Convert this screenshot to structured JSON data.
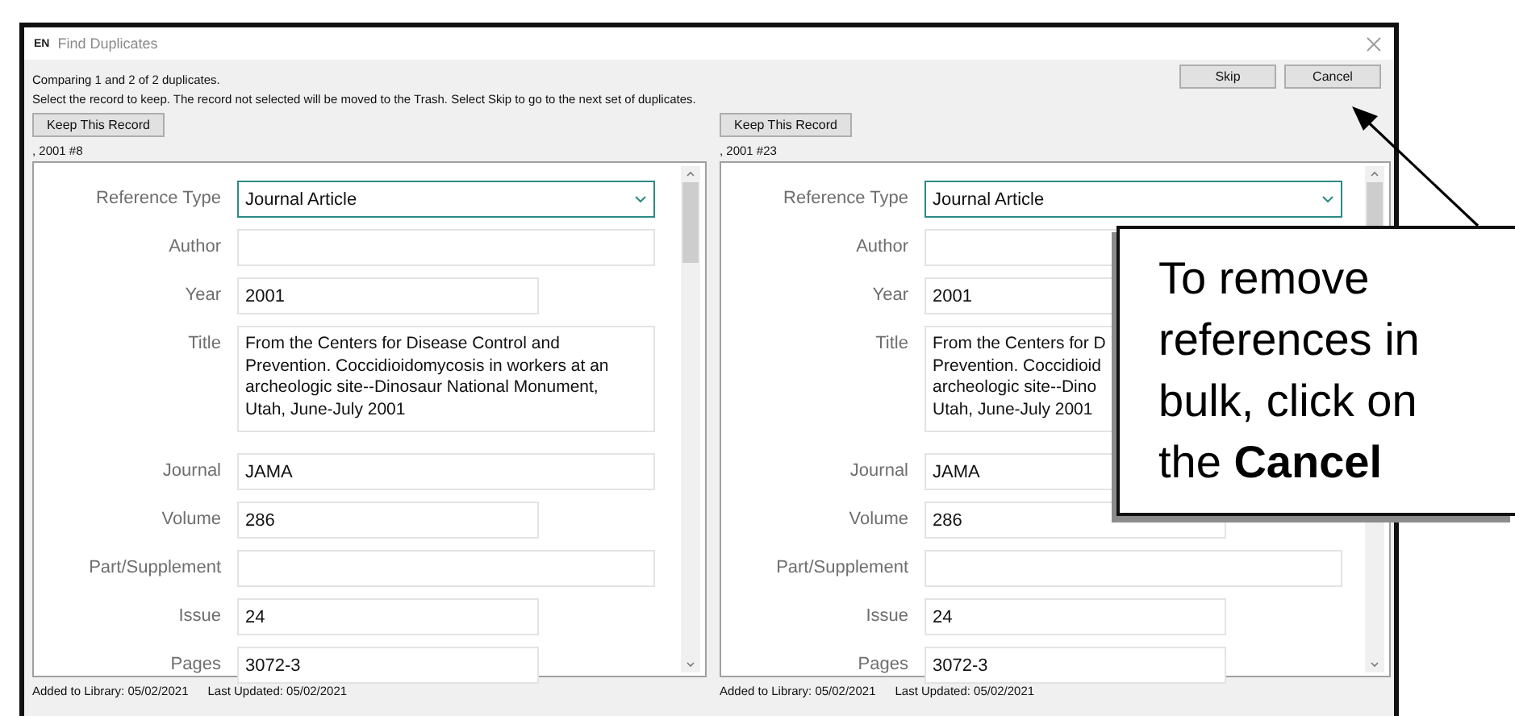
{
  "window": {
    "badge": "EN",
    "title": "Find Duplicates"
  },
  "summary": "Comparing 1 and 2 of 2 duplicates.",
  "instructions": "Select the record to keep. The record not selected will be moved to the Trash. Select Skip to go to the next set of duplicates.",
  "buttons": [
    "Skip",
    "Cancel"
  ],
  "records": [
    {
      "keep_button": "Keep This Record",
      "heading": ", 2001 #8",
      "fields": [
        {
          "label": "Reference Type",
          "kind": "dropdown",
          "value": "Journal Article"
        },
        {
          "label": "Author",
          "kind": "wide"
        },
        {
          "label": "Year",
          "kind": "narrow",
          "value": "2001"
        },
        {
          "label": "Title",
          "kind": "multiline",
          "lines": [
            "From the Centers for Disease Control and",
            "Prevention. Coccidioidomycosis in workers at an",
            "archeologic site--Dinosaur National Monument,",
            "Utah, June-July 2001"
          ]
        },
        {
          "label": "Journal",
          "kind": "wide",
          "value": "JAMA"
        },
        {
          "label": "Volume",
          "kind": "narrow",
          "value": "286"
        },
        {
          "label": "Part/Supplement",
          "kind": "wide"
        },
        {
          "label": "Issue",
          "kind": "narrow",
          "value": "24"
        },
        {
          "label": "Pages",
          "kind": "narrow",
          "value": "3072-3"
        }
      ],
      "added": "Added to Library: 05/02/2021",
      "updated": "Last Updated: 05/02/2021"
    },
    {
      "keep_button": "Keep This Record",
      "heading": ", 2001 #23",
      "fields": [
        {
          "label": "Reference Type",
          "kind": "dropdown",
          "value": "Journal Article"
        },
        {
          "label": "Author",
          "kind": "wide"
        },
        {
          "label": "Year",
          "kind": "narrow",
          "value": "2001"
        },
        {
          "label": "Title",
          "kind": "multiline",
          "lines": [
            "From the Centers for D",
            "Prevention. Coccidioid",
            "archeologic site--Dino",
            "Utah, June-July 2001"
          ]
        },
        {
          "label": "Journal",
          "kind": "wide",
          "value": "JAMA"
        },
        {
          "label": "Volume",
          "kind": "narrow",
          "value": "286"
        },
        {
          "label": "Part/Supplement",
          "kind": "wide"
        },
        {
          "label": "Issue",
          "kind": "narrow",
          "value": "24"
        },
        {
          "label": "Pages",
          "kind": "narrow",
          "value": "3072-3"
        }
      ],
      "added": "Added to Library: 05/02/2021",
      "updated": "Last Updated: 05/02/2021"
    }
  ],
  "callout": {
    "text": "To remove references in bulk, click on the **Cancel**"
  }
}
